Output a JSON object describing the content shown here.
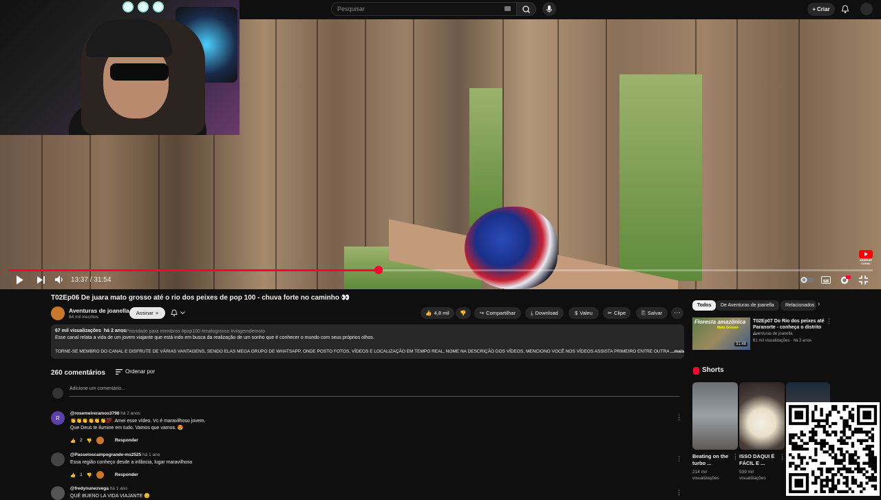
{
  "header": {
    "search_placeholder": "Pesquisar",
    "create_label": "Criar"
  },
  "player": {
    "time": "13:37 / 31:54",
    "progress_fraction": 0.428,
    "badge_text": "ASSINAR\nCANAL"
  },
  "video": {
    "title": "T02Ep06 De juara mato grosso até o rio dos peixes de pop 100 - chuva forte no caminho 👀",
    "channel": "Aventuras de joanella",
    "subscribers": "84 mil inscritos",
    "subscribe_label": "Assinar",
    "likes": "4,8 mil",
    "share_label": "Compartilhar",
    "download_label": "Download",
    "thanks_label": "Valeu",
    "clip_label": "Clipe",
    "save_label": "Salvar"
  },
  "description": {
    "views": "67 mil visualizações",
    "age": "há 2 anos",
    "tags": "⊙ Prioridade para membros  #pop100 #matogrosso #viagemdemoto",
    "line1": "Esse canal relata a vida de um jovem viajante que está indo em busca da realização de um sonho que é conhecer o mundo com seus próprios olhos.",
    "line2": "TORNE-SE MEMBRO DO CANAL E DISFRUTE DE VÁRIAS VANTAGENS,  SENDO ELAS MEGA GRUPO DE WHATSAPP, ONDE POSTO FOTOS, VÍDEOS E LOCALIZAÇÃO EM TEMPO REAL, NOME NA DESCRIÇÃO DOS VÍDEOS, MENCIONO VOCÊ NOS VÍDEOS ASSISTA PRIMEIRO ENTRE OUTRA",
    "more": "...mais"
  },
  "comments": {
    "count": "260 comentários",
    "sort_label": "Ordenar por",
    "add_placeholder": "Adicione um comentário...",
    "reply_label": "Responder",
    "items": [
      {
        "author": "@rosemeireramos3798",
        "date": "há 2 anos",
        "line1": "👏👏👏👏👏👏💯.  Amei esse vídeo.   Vc é maravilhoso jovem.",
        "line2": "Que Deus te ilumine em tudo.   Vamos que vamos.  😍",
        "likes": "2",
        "avatar_letter": "R",
        "avatar_color": "#5c3fa8"
      },
      {
        "author": "@Passeloscampogrande-ms2525",
        "date": "há 1 ano",
        "line1": "Essa região conheço desde a infância, lugar maravilhoso",
        "line2": "",
        "likes": "1",
        "avatar_letter": "",
        "avatar_color": "#444444"
      },
      {
        "author": "@fredynunezvega",
        "date": "há 1 ano",
        "line1": "QUÉ BUENO LA VIDA VIAJANTE 😊",
        "line2": "",
        "likes": "",
        "avatar_letter": "",
        "avatar_color": "#555555"
      }
    ]
  },
  "sidebar": {
    "chips": [
      "Todos",
      "De Aventuras de joanella",
      "Relacionados"
    ],
    "related": {
      "title": "T02Ep07 Do Rio dos peixes até Paranorte - conheça o distrito ...",
      "channel": "Aventuras de joanella",
      "meta": "61 mil visualizações · há 2 anos",
      "duration": "31:48",
      "thumb_text": "Floresta amazônica",
      "thumb_sub": "Mato Grosso"
    },
    "shorts_title": "Shorts",
    "shorts": [
      {
        "title": "Beating on the turbo ...",
        "views": "214 mil visualizações"
      },
      {
        "title": "ISSO DAQUI É FÁCIL E ...",
        "views": "539 mil visualizações"
      }
    ]
  },
  "colors": {
    "accent": "#ff0033",
    "background": "#0f0f0f",
    "surface": "#272727"
  }
}
